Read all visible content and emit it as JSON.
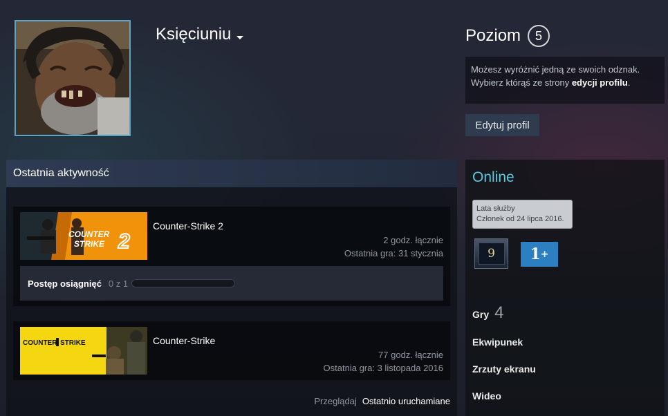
{
  "profile": {
    "persona_name": "Księciuniu",
    "level_label": "Poziom",
    "level_value": "5"
  },
  "badge_hint": {
    "line1": "Możesz wyróżnić jedną ze swoich odznak.",
    "line2_prefix": "Wybierz którąś ze strony ",
    "line2_link": "edycji profilu",
    "line2_suffix": "."
  },
  "edit_profile_label": "Edytuj profil",
  "activity": {
    "header": "Ostatnia aktywność",
    "games": [
      {
        "name": "Counter-Strike 2",
        "hours": "2 godz. łącznie",
        "last_played": "Ostatnia gra: 31 stycznia",
        "achievements_label": "Postęp osiągnięć",
        "achievements_count": "0 z 1",
        "achievements_progress": 0,
        "capsule_text": "COUNTER STRIKE"
      },
      {
        "name": "Counter-Strike",
        "hours": "77 godz. łącznie",
        "last_played": "Ostatnia gra: 3 listopada 2016",
        "capsule_text": "COUNTER STRIKE"
      }
    ],
    "browse_label": "Przeglądaj",
    "browse_value": "Ostatnio uruchamiane"
  },
  "sidebar": {
    "status": "Online",
    "years_title": "Lata służby",
    "years_text": "Członek od 24 lipca 2016.",
    "badge_nine_value": "9",
    "badge_one_value": "1",
    "badge_one_plus": "+",
    "games_label": "Gry",
    "games_count": "4",
    "inventory_label": "Ekwipunek",
    "screenshots_label": "Zrzuty ekranu",
    "videos_label": "Wideo"
  },
  "colors": {
    "online": "#57cbde",
    "badge_one_bg": "#2c80c2",
    "cs2_orange": "#f0930a",
    "cs_yellow": "#f5d711"
  }
}
